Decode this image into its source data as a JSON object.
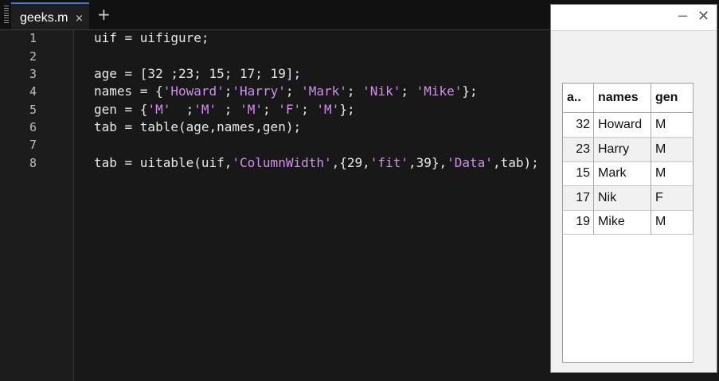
{
  "editor": {
    "tab_label": "geeks.m",
    "tab_close": "×",
    "add_tab": "+",
    "lines": [
      {
        "num": "1",
        "segments": [
          {
            "t": "uif = uifigure;",
            "k": "plain"
          }
        ]
      },
      {
        "num": "2",
        "segments": []
      },
      {
        "num": "3",
        "segments": [
          {
            "t": "age = [32 ;23; 15; 17; 19];",
            "k": "plain"
          }
        ]
      },
      {
        "num": "4",
        "segments": [
          {
            "t": "names = {",
            "k": "plain"
          },
          {
            "t": "'Howard'",
            "k": "str"
          },
          {
            "t": ";",
            "k": "plain"
          },
          {
            "t": "'Harry'",
            "k": "str"
          },
          {
            "t": "; ",
            "k": "plain"
          },
          {
            "t": "'Mark'",
            "k": "str"
          },
          {
            "t": "; ",
            "k": "plain"
          },
          {
            "t": "'Nik'",
            "k": "str"
          },
          {
            "t": "; ",
            "k": "plain"
          },
          {
            "t": "'Mike'",
            "k": "str"
          },
          {
            "t": "};",
            "k": "plain"
          }
        ]
      },
      {
        "num": "5",
        "segments": [
          {
            "t": "gen = {",
            "k": "plain"
          },
          {
            "t": "'M'",
            "k": "str"
          },
          {
            "t": "  ;",
            "k": "plain"
          },
          {
            "t": "'M'",
            "k": "str"
          },
          {
            "t": " ; ",
            "k": "plain"
          },
          {
            "t": "'M'",
            "k": "str"
          },
          {
            "t": "; ",
            "k": "plain"
          },
          {
            "t": "'F'",
            "k": "str"
          },
          {
            "t": "; ",
            "k": "plain"
          },
          {
            "t": "'M'",
            "k": "str"
          },
          {
            "t": "};",
            "k": "plain"
          }
        ]
      },
      {
        "num": "6",
        "segments": [
          {
            "t": "tab = table(age,names,gen);",
            "k": "plain"
          }
        ]
      },
      {
        "num": "7",
        "segments": []
      },
      {
        "num": "8",
        "segments": [
          {
            "t": "tab = uitable(uif,",
            "k": "plain"
          },
          {
            "t": "'ColumnWidth'",
            "k": "str"
          },
          {
            "t": ",{29,",
            "k": "plain"
          },
          {
            "t": "'fit'",
            "k": "str"
          },
          {
            "t": ",39},",
            "k": "plain"
          },
          {
            "t": "'Data'",
            "k": "str"
          },
          {
            "t": ",tab);",
            "k": "plain"
          }
        ]
      }
    ]
  },
  "figure": {
    "minimize": "−",
    "close": "✕",
    "table": {
      "headers": [
        "a..",
        "names",
        "gen"
      ],
      "rows": [
        [
          "32",
          "Howard",
          "M"
        ],
        [
          "23",
          "Harry",
          "M"
        ],
        [
          "15",
          "Mark",
          "M"
        ],
        [
          "17",
          "Nik",
          "F"
        ],
        [
          "19",
          "Mike",
          "M"
        ]
      ]
    }
  },
  "colors": {
    "string": "#d58cf0",
    "tab_accent": "#3c7bd4",
    "editor_bg": "#181818"
  }
}
